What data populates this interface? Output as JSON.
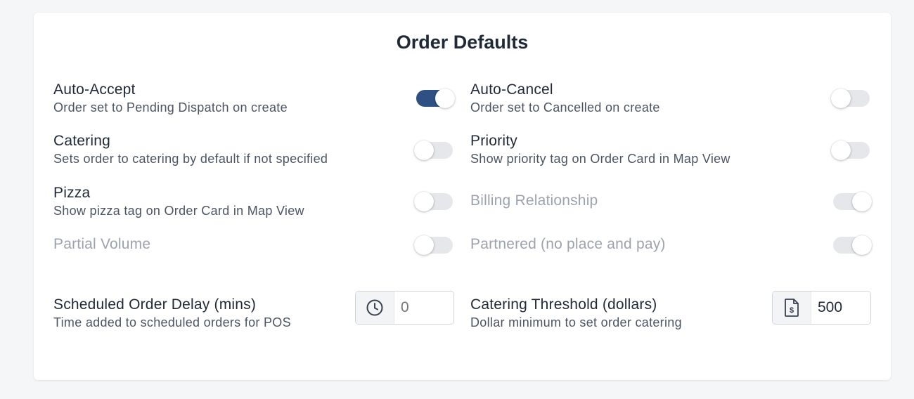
{
  "title": "Order Defaults",
  "colors": {
    "accent": "#2f5082",
    "track_off": "#e5e7eb",
    "disabled_text": "#9ca3af"
  },
  "toggles": {
    "auto_accept": {
      "label": "Auto-Accept",
      "description": "Order set to Pending Dispatch on create",
      "state": "on",
      "disabled": false
    },
    "auto_cancel": {
      "label": "Auto-Cancel",
      "description": "Order set to Cancelled on create",
      "state": "off",
      "disabled": false
    },
    "catering": {
      "label": "Catering",
      "description": "Sets order to catering by default if not specified",
      "state": "off",
      "disabled": false
    },
    "priority": {
      "label": "Priority",
      "description": "Show priority tag on Order Card in Map View",
      "state": "off",
      "disabled": false
    },
    "pizza": {
      "label": "Pizza",
      "description": "Show pizza tag on Order Card in Map View",
      "state": "off",
      "disabled": false
    },
    "billing_relationship": {
      "label": "Billing Relationship",
      "state": "on",
      "disabled": true
    },
    "partial_volume": {
      "label": "Partial Volume",
      "state": "off",
      "disabled": true
    },
    "partnered": {
      "label": "Partnered (no place and pay)",
      "state": "on",
      "disabled": true
    }
  },
  "fields": {
    "scheduled_delay": {
      "label": "Scheduled Order Delay (mins)",
      "description": "Time added to scheduled orders for POS",
      "placeholder": "0",
      "value": "",
      "icon": "clock-icon"
    },
    "catering_threshold": {
      "label": "Catering Threshold (dollars)",
      "description": "Dollar minimum to set order catering",
      "placeholder": "",
      "value": "500",
      "icon": "dollar-document-icon"
    }
  }
}
